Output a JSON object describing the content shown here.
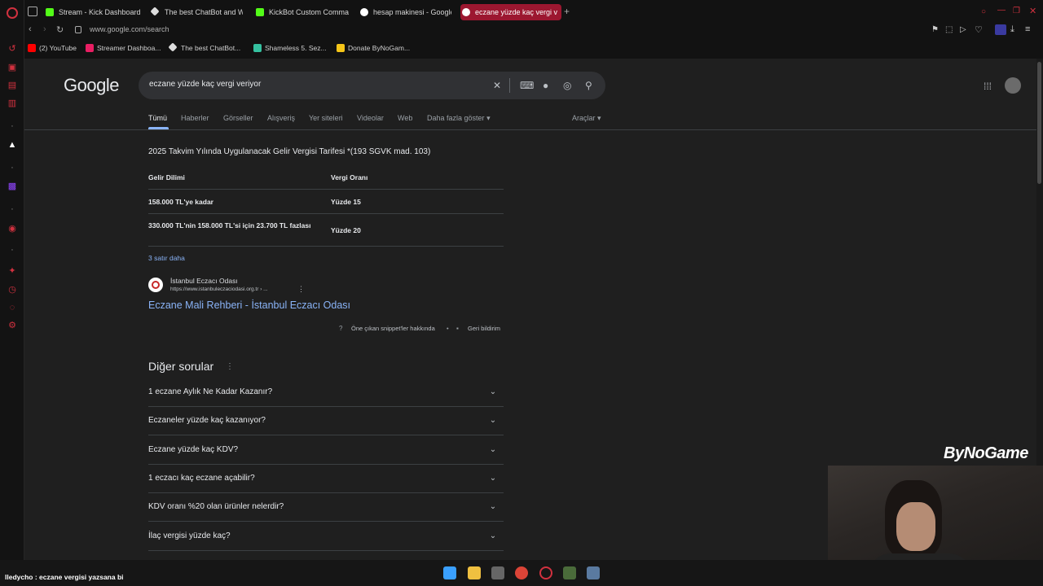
{
  "browser": {
    "tabs": [
      {
        "label": "Stream - Kick Dashboard",
        "color": "#53fc18"
      },
      {
        "label": "The best ChatBot and W",
        "color": "#ffffff"
      },
      {
        "label": "KickBot Custom Comman",
        "color": "#53fc18"
      },
      {
        "label": "hesap makinesi - Google",
        "color": "#ffffff"
      },
      {
        "label": "eczane yüzde kaç vergi v",
        "color": "#ffffff"
      }
    ],
    "new_tab": "+",
    "url": "www.google.com/search",
    "bookmarks": [
      {
        "label": "(2) YouTube",
        "color": "#ff0000"
      },
      {
        "label": "Streamer Dashboa...",
        "color": "#e91e63"
      },
      {
        "label": "The best ChatBot...",
        "color": "#ffffff"
      },
      {
        "label": "Shameless 5. Sez...",
        "color": "#35c1a0"
      },
      {
        "label": "Donate ByNoGam...",
        "color": "#f5c518"
      }
    ]
  },
  "google": {
    "logo": "Google",
    "query": "eczane yüzde kaç vergi veriyor",
    "tabs": [
      "Tümü",
      "Haberler",
      "Görseller",
      "Alışveriş",
      "Yer siteleri",
      "Videolar",
      "Web",
      "Daha fazla göster"
    ],
    "tools": "Araçlar"
  },
  "snippet": {
    "title": "2025 Takvim Yılında Uygulanacak Gelir Vergisi Tarifesi *(193 SGVK mad. 103)",
    "table": {
      "headers": [
        "Gelir Dilimi",
        "Vergi Oranı"
      ],
      "rows": [
        [
          "158.000 TL'ye kadar",
          "Yüzde 15"
        ],
        [
          "330.000 TL'nin 158.000 TL'si için 23.700 TL fazlası",
          "Yüzde 20"
        ]
      ]
    },
    "more_rows": "3 satır daha",
    "source_name": "İstanbul Eczacı Odası",
    "source_url": "https://www.istanbuleczaciodasi.org.tr › ...",
    "link": "Eczane Mali Rehberi - İstanbul Eczacı Odası",
    "about": "Öne çıkan snippet'ler hakkında",
    "feedback": "Geri bildirim"
  },
  "paa": {
    "title": "Diğer sorular",
    "questions": [
      "1 eczane Aylık Ne Kadar Kazanır?",
      "Eczaneler yüzde kaç kazanıyor?",
      "Eczane yüzde kaç KDV?",
      "1 eczacı kaç eczane açabilir?",
      "KDV oranı %20 olan ürünler nelerdir?",
      "İlaç vergisi yüzde kaç?"
    ]
  },
  "overlay": {
    "chat": "lledycho : eczane vergisi yazsana bi",
    "brand": "ByNoGame"
  }
}
